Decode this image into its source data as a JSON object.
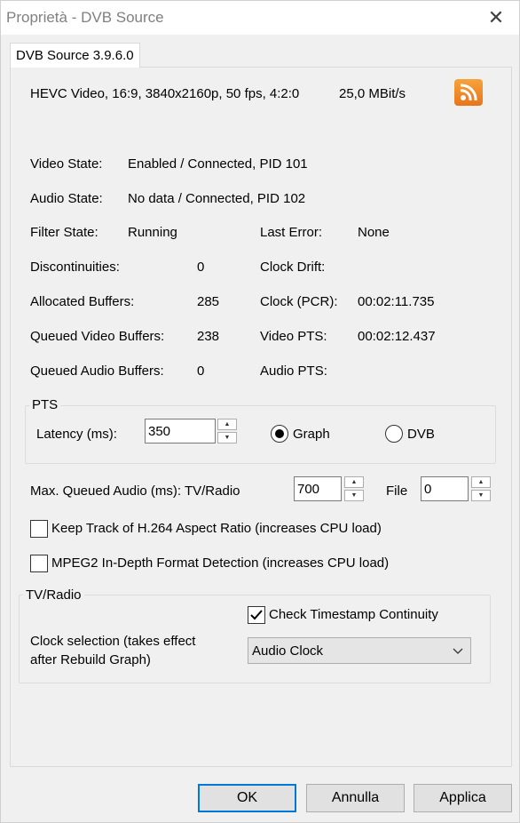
{
  "window": {
    "title": "Proprietà - DVB Source",
    "close_glyph": "✕"
  },
  "tab": {
    "label": "DVB Source 3.9.6.0"
  },
  "stream_info": {
    "format": "HEVC Video, 16:9, 3840x2160p, 50 fps, 4:2:0",
    "bitrate": "25,0 MBit/s",
    "icon": "rss-feed-icon"
  },
  "status": {
    "video_state_label": "Video State:",
    "video_state_value": "Enabled / Connected, PID 101",
    "audio_state_label": "Audio State:",
    "audio_state_value": "No data / Connected, PID 102",
    "filter_state_label": "Filter State:",
    "filter_state_value": "Running",
    "last_error_label": "Last Error:",
    "last_error_value": "None",
    "discontinuities_label": "Discontinuities:",
    "discontinuities_value": "0",
    "clock_drift_label": "Clock Drift:",
    "clock_drift_value": "",
    "allocated_buffers_label": "Allocated Buffers:",
    "allocated_buffers_value": "285",
    "clock_pcr_label": "Clock (PCR):",
    "clock_pcr_value": "00:02:11.735",
    "queued_video_label": "Queued Video Buffers:",
    "queued_video_value": "238",
    "video_pts_label": "Video PTS:",
    "video_pts_value": "00:02:12.437",
    "queued_audio_label": "Queued Audio Buffers:",
    "queued_audio_value": "0",
    "audio_pts_label": "Audio PTS:",
    "audio_pts_value": ""
  },
  "pts": {
    "group_label": "PTS",
    "latency_label": "Latency (ms):",
    "latency_value": "350",
    "graph_label": "Graph",
    "dvb_label": "DVB",
    "selected": "Graph"
  },
  "max_queued": {
    "label": "Max. Queued Audio (ms): TV/Radio",
    "tv_radio_value": "700",
    "file_label": "File",
    "file_value": "0"
  },
  "options": {
    "h264_label": "Keep Track of H.264 Aspect Ratio (increases CPU load)",
    "h264_checked": false,
    "mpeg2_label": "MPEG2 In-Depth Format Detection (increases CPU load)",
    "mpeg2_checked": false
  },
  "tv_radio": {
    "group_label": "TV/Radio",
    "timestamp_label": "Check Timestamp Continuity",
    "timestamp_checked": true,
    "clock_label_line1": "Clock selection (takes effect",
    "clock_label_line2": "after Rebuild Graph)",
    "clock_value": "Audio Clock"
  },
  "buttons": {
    "ok": "OK",
    "cancel": "Annulla",
    "apply": "Applica"
  },
  "colors": {
    "accent": "#0078d7",
    "rss": "#f39a2e"
  }
}
